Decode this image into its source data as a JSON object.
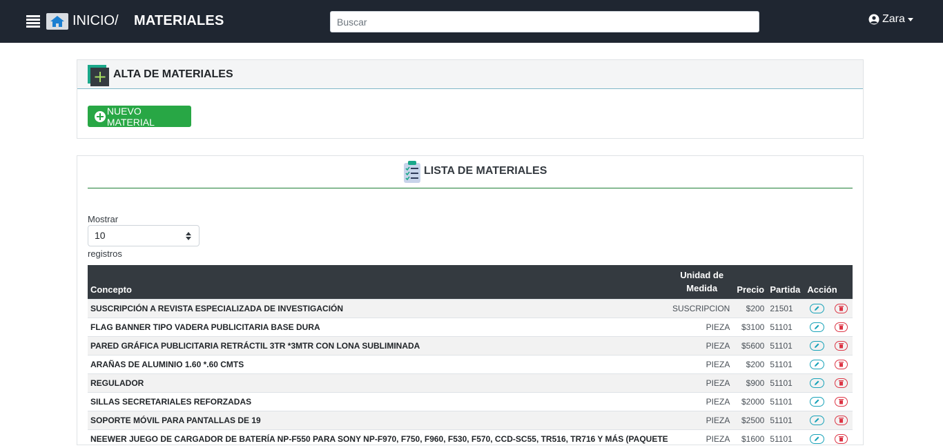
{
  "topbar": {
    "breadcrumb_home": "INICIO",
    "breadcrumb_sep": "/",
    "page_title": "MATERIALES",
    "search_placeholder": "Buscar",
    "user_name": "Zara"
  },
  "alta": {
    "title": "ALTA DE MATERIALES",
    "new_button": "NUEVO MATERIAL"
  },
  "lista": {
    "title": "LISTA DE MATERIALES",
    "show_label": "Mostrar",
    "page_size": "10",
    "records_label": "registros",
    "columns": {
      "concepto": "Concepto",
      "unidad": "Unidad de Medida",
      "precio": "Precio",
      "partida": "Partida",
      "accion": "Acción"
    },
    "rows": [
      {
        "concepto": "SUSCRIPCIÓN A REVISTA ESPECIALIZADA DE INVESTIGACIÓN",
        "unidad": "SUSCRIPCION",
        "precio": "$200",
        "partida": "21501"
      },
      {
        "concepto": "FLAG BANNER TIPO VADERA PUBLICITARIA BASE DURA",
        "unidad": "PIEZA",
        "precio": "$3100",
        "partida": "51101"
      },
      {
        "concepto": "PARED GRÁFICA PUBLICITARIA RETRÁCTIL 3TR *3MTR CON LONA SUBLIMINADA",
        "unidad": "PIEZA",
        "precio": "$5600",
        "partida": "51101"
      },
      {
        "concepto": "ARAÑAS DE ALUMINIO 1.60 *.60 CMTS",
        "unidad": "PIEZA",
        "precio": "$200",
        "partida": "51101"
      },
      {
        "concepto": "REGULADOR",
        "unidad": "PIEZA",
        "precio": "$900",
        "partida": "51101"
      },
      {
        "concepto": "SILLAS SECRETARIALES REFORZADAS",
        "unidad": "PIEZA",
        "precio": "$2000",
        "partida": "51101"
      },
      {
        "concepto": "SOPORTE MÓVIL PARA PANTALLAS DE 19",
        "unidad": "PIEZA",
        "precio": "$2500",
        "partida": "51101"
      },
      {
        "concepto": "NEEWER JUEGO DE CARGADOR DE BATERÍA NP-F550 PARA SONY NP-F970, F750, F960, F530, F570, CCD-SC55, TR516, TR716 Y MÁS (PAQUETE DE",
        "unidad": "PIEZA",
        "precio": "$1600",
        "partida": "51101"
      }
    ]
  },
  "colors": {
    "navbar": "#1f2631",
    "success": "#28a745",
    "table_header": "#343a40",
    "edit": "#17a2b8",
    "delete": "#dc3545"
  },
  "icons": [
    "menu-icon",
    "home-icon",
    "user-circle-icon",
    "caret-down-icon",
    "add-square-icon",
    "plus-circle-icon",
    "clipboard-list-icon",
    "select-arrows-icon",
    "pencil-icon",
    "trash-icon"
  ]
}
